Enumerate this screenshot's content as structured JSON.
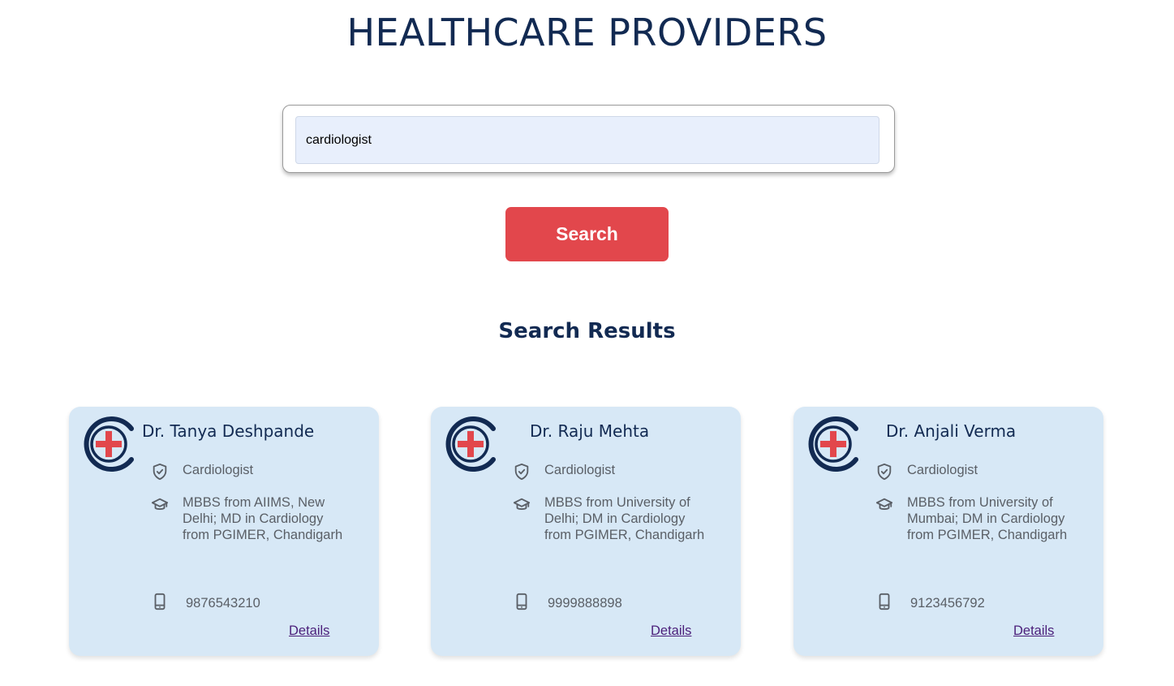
{
  "page": {
    "title": "HEALTHCARE PROVIDERS"
  },
  "search": {
    "value": "cardiologist",
    "button_label": "Search"
  },
  "results": {
    "heading": "Search Results",
    "providers": [
      {
        "name": "Dr. Tanya Deshpande",
        "specialty": "Cardiologist",
        "education": "MBBS from AIIMS, New Delhi; MD in Cardiology from PGIMER, Chandigarh",
        "phone": "9876543210",
        "details_label": "Details"
      },
      {
        "name": "Dr. Raju Mehta",
        "specialty": "Cardiologist",
        "education": "MBBS from University of Delhi; DM in Cardiology from PGIMER, Chandigarh",
        "phone": "9999888898",
        "details_label": "Details"
      },
      {
        "name": "Dr. Anjali Verma",
        "specialty": "Cardiologist",
        "education": "MBBS from University of Mumbai; DM in Cardiology from PGIMER, Chandigarh",
        "phone": "9123456792",
        "details_label": "Details"
      }
    ]
  },
  "icons": {
    "logo": "medical-cross-logo-icon",
    "specialty": "shield-check-icon",
    "education": "graduation-cap-icon",
    "phone": "mobile-phone-icon"
  },
  "colors": {
    "brand_navy": "#122a52",
    "accent_red": "#e2474c",
    "card_background": "#d7e8f6",
    "input_background": "#e8effc",
    "link": "#4b1f7a"
  }
}
